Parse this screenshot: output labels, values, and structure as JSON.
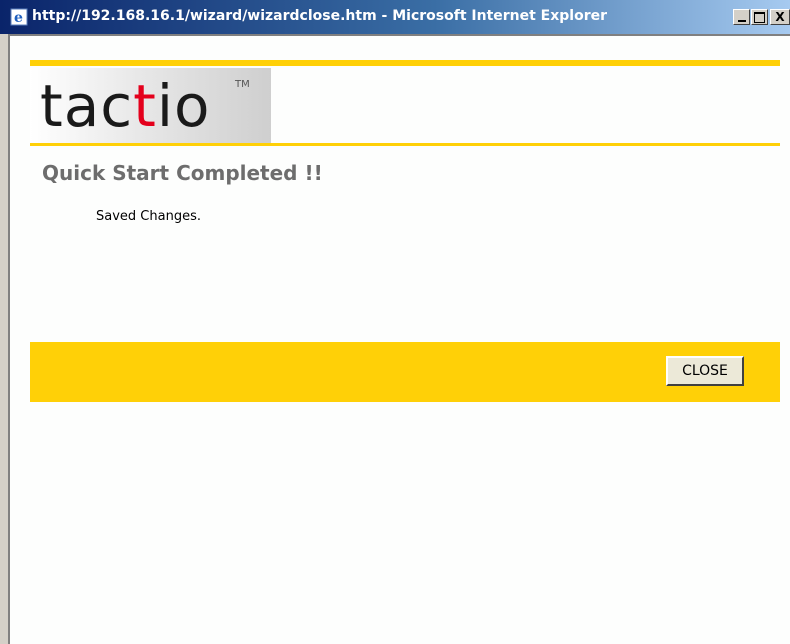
{
  "window": {
    "title": "http://192.168.16.1/wizard/wizardclose.htm - Microsoft Internet Explorer",
    "icon": "ie-icon",
    "controls": [
      "minimize-icon",
      "maximize-icon",
      "close-icon"
    ],
    "close_glyph": "X"
  },
  "logo": {
    "part1": "tac",
    "part2": "t",
    "part3": "io",
    "tm": "TM"
  },
  "page": {
    "heading": "Quick Start Completed !!",
    "message": "Saved Changes.",
    "close_button": "CLOSE"
  },
  "colors": {
    "accent": "#ffd007",
    "logo_red": "#e4001c",
    "heading": "#6d6d6d",
    "titlebar": "#0a246a"
  }
}
